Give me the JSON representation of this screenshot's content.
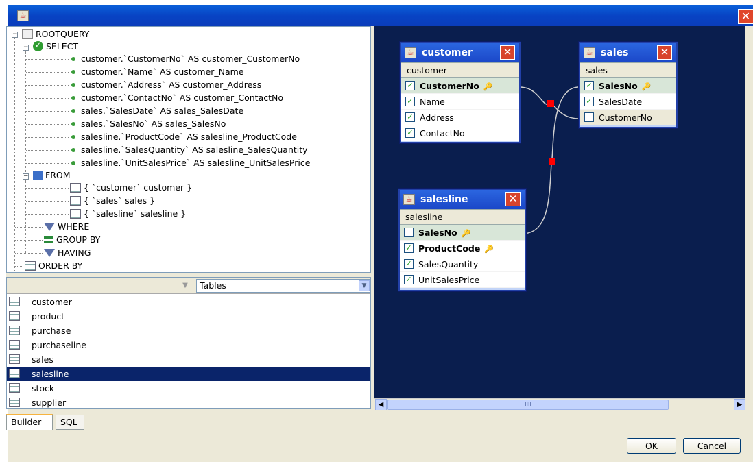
{
  "window": {
    "close_label": "✕"
  },
  "tree": {
    "root": "ROOTQUERY",
    "select": "SELECT",
    "select_items": [
      "customer.`CustomerNo` AS customer_CustomerNo",
      "customer.`Name` AS customer_Name",
      "customer.`Address` AS customer_Address",
      "customer.`ContactNo` AS customer_ContactNo",
      "sales.`SalesDate` AS sales_SalesDate",
      "sales.`SalesNo` AS sales_SalesNo",
      "salesline.`ProductCode` AS salesline_ProductCode",
      "salesline.`SalesQuantity` AS salesline_SalesQuantity",
      "salesline.`UnitSalesPrice` AS salesline_UnitSalesPrice"
    ],
    "from": "FROM",
    "from_items": [
      "{ `customer` customer }",
      "{ `sales` sales }",
      "{ `salesline` salesline }"
    ],
    "where": "WHERE",
    "group_by": "GROUP BY",
    "having": "HAVING",
    "order_by": "ORDER BY"
  },
  "tables_panel": {
    "combo_value": "Tables",
    "items": [
      "customer",
      "product",
      "purchase",
      "purchaseline",
      "sales",
      "salesline",
      "stock",
      "supplier"
    ],
    "selected": "salesline"
  },
  "canvas_tables": {
    "customer": {
      "title": "customer",
      "alias": "customer",
      "columns": [
        {
          "name": "CustomerNo",
          "checked": true,
          "key": true
        },
        {
          "name": "Name",
          "checked": true,
          "key": false
        },
        {
          "name": "Address",
          "checked": true,
          "key": false
        },
        {
          "name": "ContactNo",
          "checked": true,
          "key": false
        }
      ]
    },
    "sales": {
      "title": "sales",
      "alias": "sales",
      "columns": [
        {
          "name": "SalesNo",
          "checked": true,
          "key": true
        },
        {
          "name": "SalesDate",
          "checked": true,
          "key": false
        },
        {
          "name": "CustomerNo",
          "checked": false,
          "key": false
        }
      ]
    },
    "salesline": {
      "title": "salesline",
      "alias": "salesline",
      "columns": [
        {
          "name": "SalesNo",
          "checked": false,
          "key": true
        },
        {
          "name": "ProductCode",
          "checked": true,
          "key": true
        },
        {
          "name": "SalesQuantity",
          "checked": true,
          "key": false
        },
        {
          "name": "UnitSalesPrice",
          "checked": true,
          "key": false
        }
      ]
    }
  },
  "scroll": {
    "thumb_label": "IIII"
  },
  "tabs": {
    "builder": "Builder",
    "sql": "SQL"
  },
  "buttons": {
    "ok": "OK",
    "cancel": "Cancel"
  },
  "colors": {
    "canvas_bg": "#0a1e4e",
    "selection": "#0a246a",
    "join_marker": "#ff0000"
  }
}
